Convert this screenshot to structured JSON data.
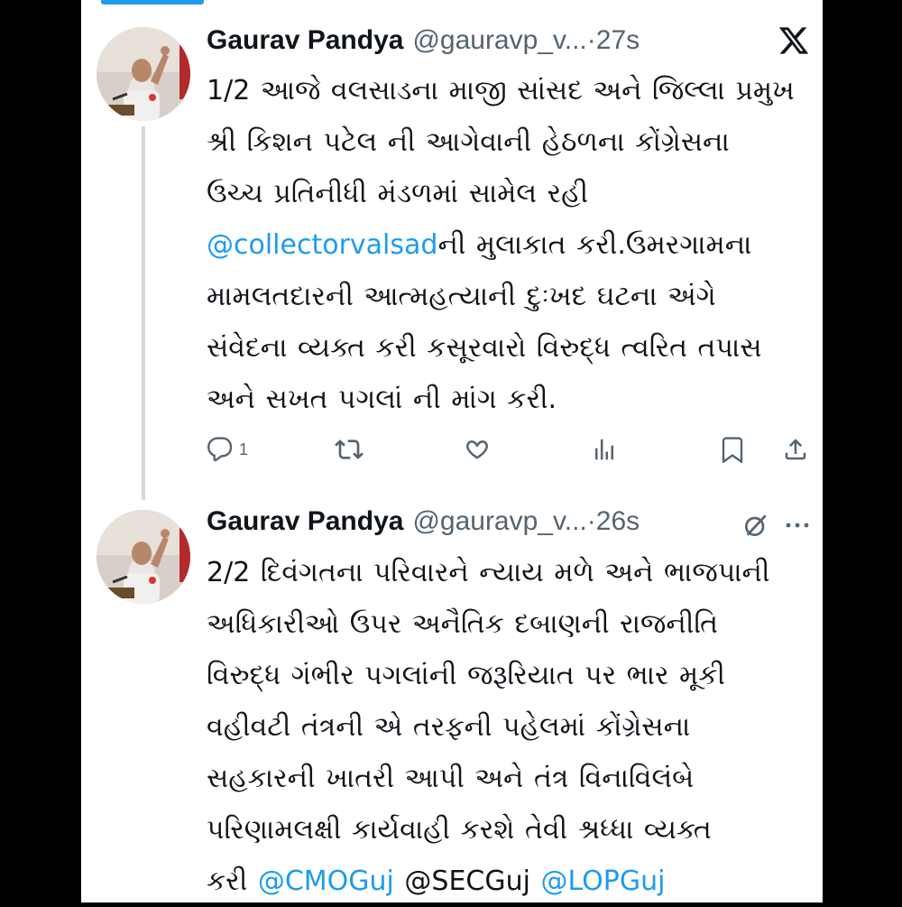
{
  "colors": {
    "accent": "#1d9bf0",
    "text": "#0f1419",
    "muted": "#536471",
    "thread_line": "#cfd9de"
  },
  "tweets": [
    {
      "name": "Gaurav Pandya",
      "handle": "@gauravp_v...",
      "time": "·27s",
      "lines": [
        [
          {
            "text": "1/2 આજે વલસાડના માજી સાંસદ અને જિલ્લા પ્રમુખ"
          }
        ],
        [
          {
            "text": "શ્રી કિશન પટેલ ની આગેવાની હેઠળના કોંગ્રેસના"
          }
        ],
        [
          {
            "text": "ઉચ્ચ પ્રતિનીધી મંડળમાં સામેલ રહી"
          }
        ],
        [
          {
            "text": "@collectorvalsad",
            "mention": true
          },
          {
            "text": "ની મુલાકાત કરી.ઉમરગામના"
          }
        ],
        [
          {
            "text": "મામલતદારની આત્મહત્યાની દુઃખદ ઘટના અંગે"
          }
        ],
        [
          {
            "text": "સંવેદના વ્યક્ત કરી કસૂરવારો વિરુદ્ધ ત્વરિત તપાસ"
          }
        ],
        [
          {
            "text": "અને સખત પગલાં ની માંગ કરી."
          }
        ]
      ],
      "actions": {
        "reply_count": "1",
        "icons": [
          "reply-icon",
          "retweet-icon",
          "like-icon",
          "views-icon",
          "bookmark-icon",
          "share-icon"
        ]
      },
      "corner_icon": "x-logo-icon"
    },
    {
      "name": "Gaurav Pandya",
      "handle": "@gauravp_v...",
      "time": "·26s",
      "lines": [
        [
          {
            "text": "2/2 દિવંગતના પરિવારને ન્યાય મળે અને ભાજપાની"
          }
        ],
        [
          {
            "text": "અધિકારીઓ ઉપર અનૈતિક દબાણની રાજનીતિ"
          }
        ],
        [
          {
            "text": "વિરુદ્ધ ગંભીર પગલાંની જરૂરિયાત પર ભાર મૂકી"
          }
        ],
        [
          {
            "text": "વહીવટી તંત્રની એ તરફની પહેલમાં કોંગ્રેસના"
          }
        ],
        [
          {
            "text": "સહકારની ખાતરી આપી અને તંત્ર વિનાવિલંબે"
          }
        ],
        [
          {
            "text": "પરિણામલક્ષી કાર્યવાહી કરશે તેવી શ્રધ્ધા વ્યક્ત"
          }
        ],
        [
          {
            "text": "કરી "
          },
          {
            "text": "@CMOGuj",
            "mention": true
          },
          {
            "text": " @SECGuj "
          },
          {
            "text": "@LOPGuj",
            "mention": true
          }
        ]
      ],
      "corner_icons": [
        "grok-icon",
        "more-icon"
      ]
    }
  ]
}
